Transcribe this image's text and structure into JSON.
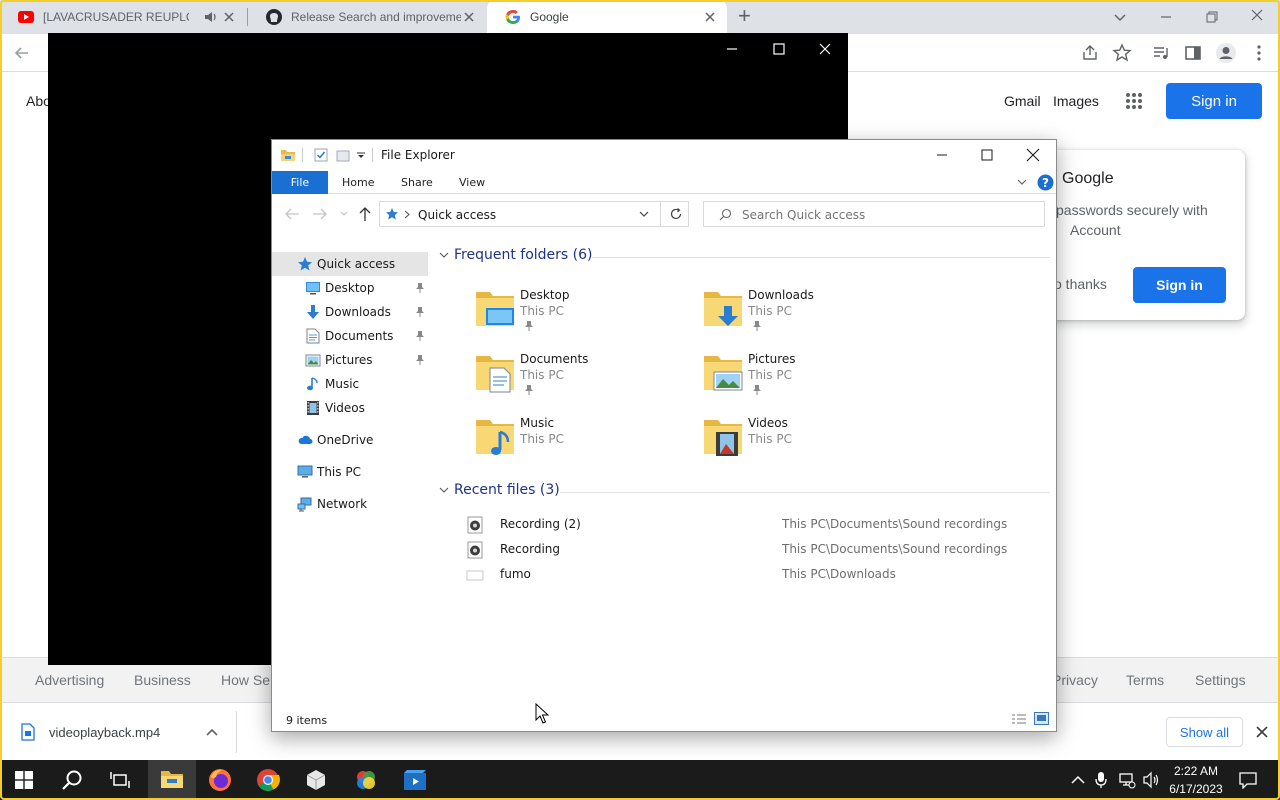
{
  "browser": {
    "tabs": [
      {
        "title": "[LAVACRUSADER REUPLOAD",
        "icon": "youtube-icon",
        "muted_icon": "speaker-icon"
      },
      {
        "title": "Release Search and improvemen",
        "icon": "github-icon"
      },
      {
        "title": "Google",
        "icon": "google-icon"
      }
    ],
    "new_tab": "+",
    "page": {
      "about_label": "Abo",
      "gmail": "Gmail",
      "images": "Images",
      "sign_in": "Sign in",
      "card": {
        "title": "Google",
        "line1": "passwords securely with",
        "line2": "Account",
        "no_thanks": "o thanks",
        "sign_in": "Sign in"
      },
      "footer_left": [
        "Advertising",
        "Business",
        "How Se"
      ],
      "footer_right": [
        "Privacy",
        "Terms",
        "Settings"
      ]
    },
    "download": {
      "file": "videoplayback.mp4",
      "show_all": "Show all"
    }
  },
  "explorer": {
    "title": "File Explorer",
    "ribbon_tabs": [
      "File",
      "Home",
      "Share",
      "View"
    ],
    "address": "Quick access",
    "search_placeholder": "Search Quick access",
    "nav": {
      "quick_access": "Quick access",
      "pinned": [
        "Desktop",
        "Downloads",
        "Documents",
        "Pictures"
      ],
      "others": [
        "Music",
        "Videos"
      ],
      "onedrive": "OneDrive",
      "this_pc": "This PC",
      "network": "Network"
    },
    "frequent_header": "Frequent folders (6)",
    "folders": [
      {
        "name": "Desktop",
        "location": "This PC",
        "pinned": true
      },
      {
        "name": "Downloads",
        "location": "This PC",
        "pinned": true
      },
      {
        "name": "Documents",
        "location": "This PC",
        "pinned": true
      },
      {
        "name": "Pictures",
        "location": "This PC",
        "pinned": true
      },
      {
        "name": "Music",
        "location": "This PC",
        "pinned": false
      },
      {
        "name": "Videos",
        "location": "This PC",
        "pinned": false
      }
    ],
    "recent_header": "Recent files (3)",
    "recent": [
      {
        "name": "Recording (2)",
        "path": "This PC\\Documents\\Sound recordings"
      },
      {
        "name": "Recording",
        "path": "This PC\\Documents\\Sound recordings"
      },
      {
        "name": "fumo",
        "path": "This PC\\Downloads"
      }
    ],
    "status": "9 items"
  },
  "taskbar": {
    "time": "2:22 AM",
    "date": "6/17/2023"
  },
  "colors": {
    "accent": "#1a73e8",
    "explorer_file_tab": "#1a6fd2",
    "section_heading": "#1e3287",
    "taskbar": "#1b1b1b",
    "frame": "#f2cf2a"
  }
}
